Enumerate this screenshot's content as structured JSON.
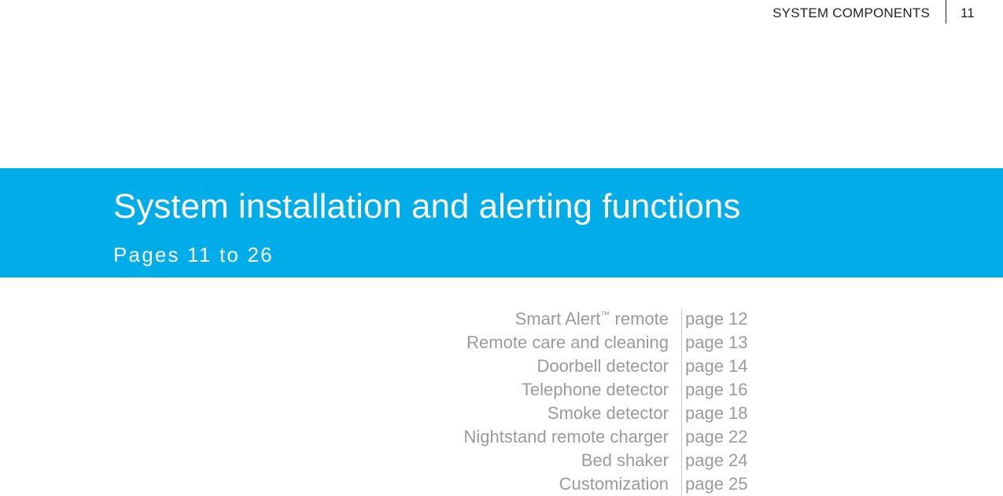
{
  "header": {
    "section_title": "SYSTEM COMPONENTS",
    "page_number": "11"
  },
  "banner": {
    "title": "System installation and alerting functions",
    "subtitle": "Pages 11 to 26",
    "background_color": "#00ade8",
    "text_color": "#ffffff"
  },
  "contents": {
    "divider_color": "#c9c9c9",
    "text_color": "#9a9a9a",
    "rows": [
      {
        "label": "Smart Alert",
        "trademark": "™",
        "label_suffix": " remote",
        "page": "page 12"
      },
      {
        "label": "Remote care and cleaning",
        "trademark": "",
        "label_suffix": "",
        "page": "page 13"
      },
      {
        "label": "Doorbell detector",
        "trademark": "",
        "label_suffix": "",
        "page": "page 14"
      },
      {
        "label": "Telephone detector",
        "trademark": "",
        "label_suffix": "",
        "page": "page 16"
      },
      {
        "label": "Smoke detector",
        "trademark": "",
        "label_suffix": "",
        "page": "page 18"
      },
      {
        "label": "Nightstand remote charger",
        "trademark": "",
        "label_suffix": "",
        "page": "page 22"
      },
      {
        "label": "Bed shaker",
        "trademark": "",
        "label_suffix": "",
        "page": "page 24"
      },
      {
        "label": "Customization",
        "trademark": "",
        "label_suffix": "",
        "page": "page 25"
      }
    ]
  }
}
